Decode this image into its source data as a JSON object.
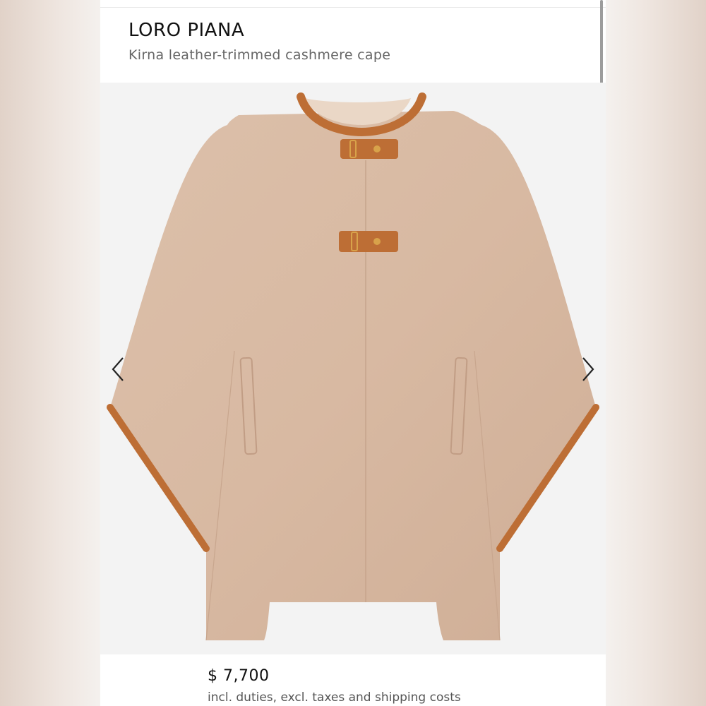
{
  "product": {
    "brand": "LORO PIANA",
    "name": "Kirna leather-trimmed cashmere cape",
    "price": "$ 7,700",
    "price_note": "incl. duties, excl. taxes and shipping costs"
  },
  "gallery": {
    "prev_icon": "chevron-left-icon",
    "next_icon": "chevron-right-icon"
  },
  "colors": {
    "cape_fabric": "#d8b9a2",
    "leather_trim": "#bd6e35",
    "background": "#f3f3f3"
  }
}
